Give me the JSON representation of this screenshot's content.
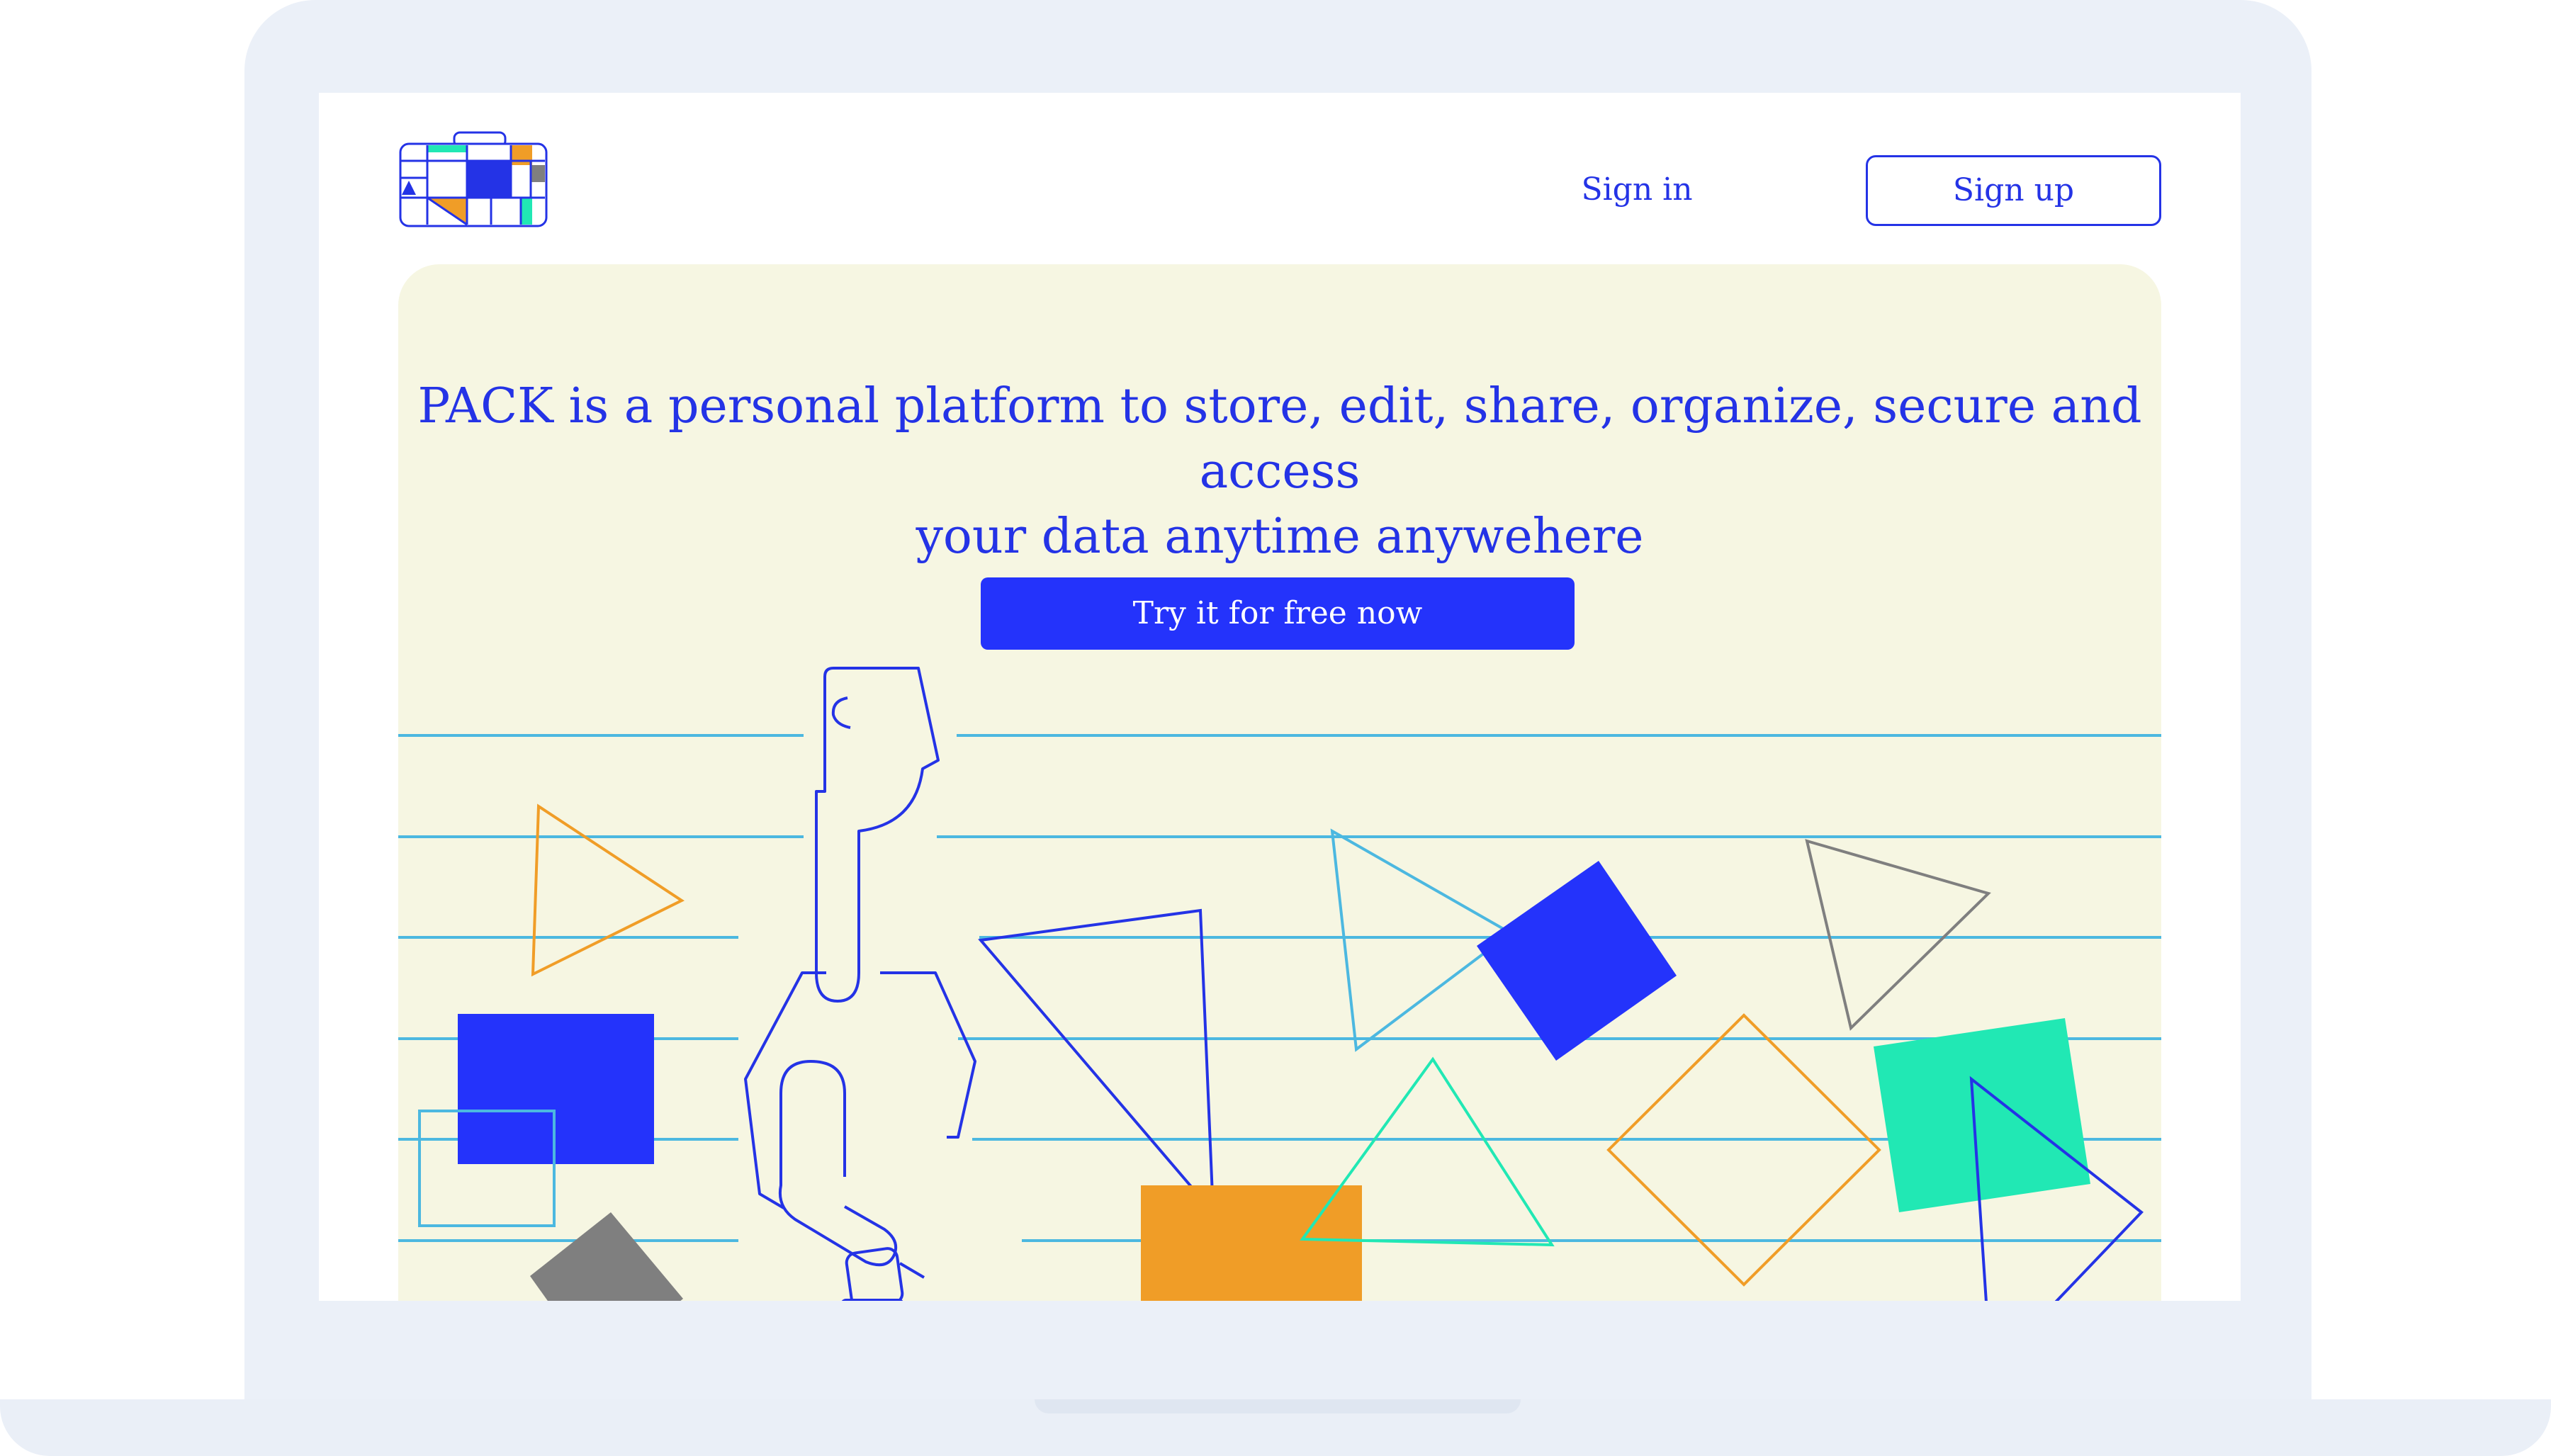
{
  "nav": {
    "sign_in": "Sign in",
    "sign_up": "Sign up"
  },
  "hero": {
    "headline_line1": "PACK is a personal platform to store, edit, share, organize, secure and access",
    "headline_line2": "your data anytime anywehere",
    "cta": "Try it for free now"
  },
  "colors": {
    "brand_blue": "#2433e6",
    "cta_blue": "#2433fb",
    "hero_background": "#f6f6e2",
    "accent_orange": "#f09d27",
    "accent_teal": "#21e8b4",
    "accent_cyan": "#4cb8e0",
    "accent_gray": "#7f7f7f",
    "laptop_frame": "#ebf0f8"
  },
  "icons": {
    "logo": "pack-suitcase-logo-icon",
    "hero_art": "person-with-suitcase-illustration"
  }
}
